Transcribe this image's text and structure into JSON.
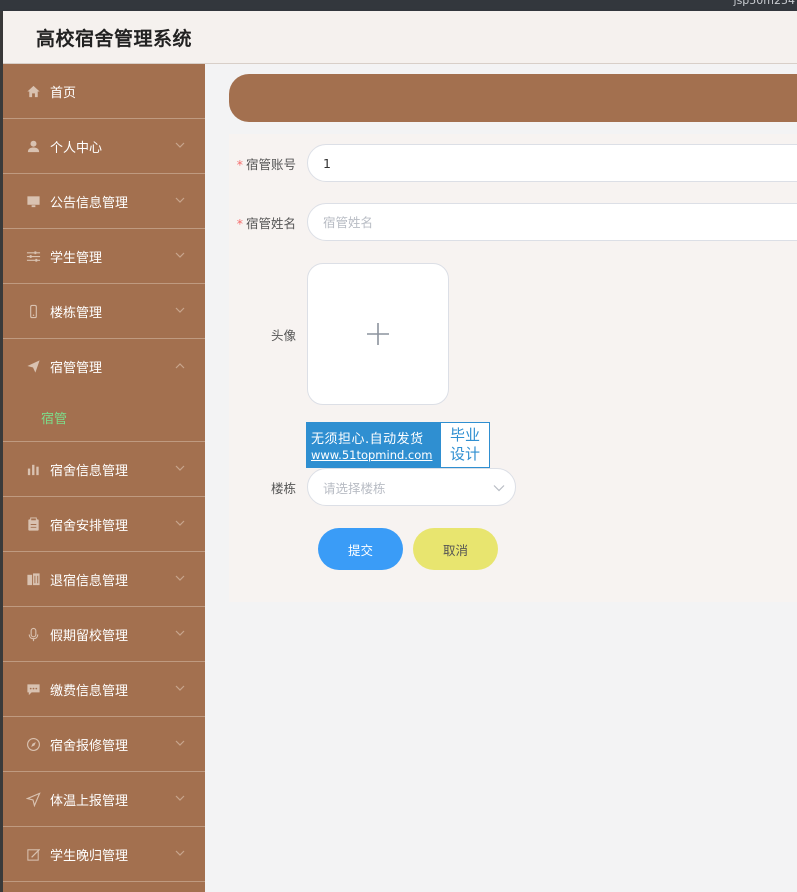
{
  "app": {
    "top_strip_text": "jsp50m254",
    "title": "高校宿舍管理系统"
  },
  "sidebar": {
    "items": [
      {
        "label": "首页",
        "icon": "home-icon",
        "has_chevron": false
      },
      {
        "label": "个人中心",
        "icon": "user-icon",
        "has_chevron": true
      },
      {
        "label": "公告信息管理",
        "icon": "monitor-icon",
        "has_chevron": true
      },
      {
        "label": "学生管理",
        "icon": "sliders-icon",
        "has_chevron": true
      },
      {
        "label": "楼栋管理",
        "icon": "phone-icon",
        "has_chevron": true
      },
      {
        "label": "宿管管理",
        "icon": "send-icon",
        "has_chevron": true,
        "expanded": true,
        "sub": [
          {
            "label": "宿管"
          }
        ]
      },
      {
        "label": "宿舍信息管理",
        "icon": "bar-chart-icon",
        "has_chevron": true
      },
      {
        "label": "宿舍安排管理",
        "icon": "clipboard-icon",
        "has_chevron": true
      },
      {
        "label": "退宿信息管理",
        "icon": "building-icon",
        "has_chevron": true
      },
      {
        "label": "假期留校管理",
        "icon": "microphone-icon",
        "has_chevron": true
      },
      {
        "label": "缴费信息管理",
        "icon": "chat-icon",
        "has_chevron": true
      },
      {
        "label": "宿舍报修管理",
        "icon": "compass-icon",
        "has_chevron": true
      },
      {
        "label": "体温上报管理",
        "icon": "location-arrow-icon",
        "has_chevron": true
      },
      {
        "label": "学生晚归管理",
        "icon": "edit-icon",
        "has_chevron": true
      }
    ]
  },
  "form": {
    "account": {
      "label": "宿管账号",
      "required": true,
      "value": "1"
    },
    "name": {
      "label": "宿管姓名",
      "required": true,
      "value": "",
      "placeholder": "宿管姓名"
    },
    "avatar": {
      "label": "头像",
      "icon": "plus-icon"
    },
    "building": {
      "label": "楼栋",
      "placeholder": "请选择楼栋",
      "icon": "chevron-down-icon"
    },
    "submit_label": "提交",
    "cancel_label": "取消"
  },
  "watermark": {
    "line1": "无须担心.自动发货",
    "line2": "www.51topmind.com",
    "right_top": "毕业",
    "right_bottom": "设计"
  },
  "colors": {
    "sidebar_bg": "#a3704f",
    "active_sub": "#7ddc8a",
    "submit": "#3a9cf7",
    "cancel": "#e8e56f",
    "required": "#f56c6c"
  }
}
